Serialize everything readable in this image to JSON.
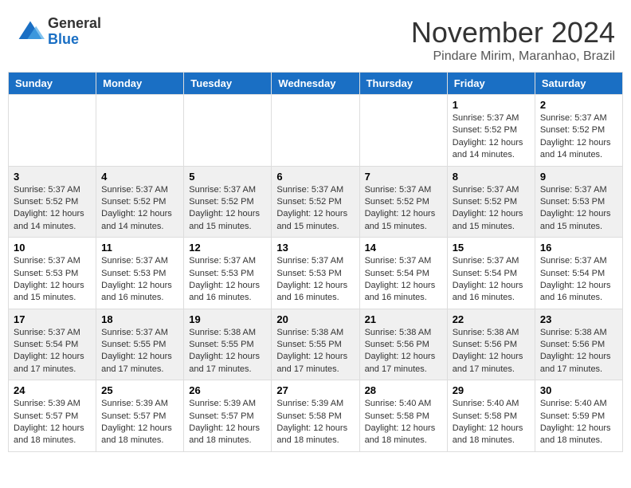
{
  "header": {
    "logo_general": "General",
    "logo_blue": "Blue",
    "month_title": "November 2024",
    "location": "Pindare Mirim, Maranhao, Brazil"
  },
  "weekdays": [
    "Sunday",
    "Monday",
    "Tuesday",
    "Wednesday",
    "Thursday",
    "Friday",
    "Saturday"
  ],
  "weeks": [
    [
      {
        "day": "",
        "info": ""
      },
      {
        "day": "",
        "info": ""
      },
      {
        "day": "",
        "info": ""
      },
      {
        "day": "",
        "info": ""
      },
      {
        "day": "",
        "info": ""
      },
      {
        "day": "1",
        "info": "Sunrise: 5:37 AM\nSunset: 5:52 PM\nDaylight: 12 hours\nand 14 minutes."
      },
      {
        "day": "2",
        "info": "Sunrise: 5:37 AM\nSunset: 5:52 PM\nDaylight: 12 hours\nand 14 minutes."
      }
    ],
    [
      {
        "day": "3",
        "info": "Sunrise: 5:37 AM\nSunset: 5:52 PM\nDaylight: 12 hours\nand 14 minutes."
      },
      {
        "day": "4",
        "info": "Sunrise: 5:37 AM\nSunset: 5:52 PM\nDaylight: 12 hours\nand 14 minutes."
      },
      {
        "day": "5",
        "info": "Sunrise: 5:37 AM\nSunset: 5:52 PM\nDaylight: 12 hours\nand 15 minutes."
      },
      {
        "day": "6",
        "info": "Sunrise: 5:37 AM\nSunset: 5:52 PM\nDaylight: 12 hours\nand 15 minutes."
      },
      {
        "day": "7",
        "info": "Sunrise: 5:37 AM\nSunset: 5:52 PM\nDaylight: 12 hours\nand 15 minutes."
      },
      {
        "day": "8",
        "info": "Sunrise: 5:37 AM\nSunset: 5:52 PM\nDaylight: 12 hours\nand 15 minutes."
      },
      {
        "day": "9",
        "info": "Sunrise: 5:37 AM\nSunset: 5:53 PM\nDaylight: 12 hours\nand 15 minutes."
      }
    ],
    [
      {
        "day": "10",
        "info": "Sunrise: 5:37 AM\nSunset: 5:53 PM\nDaylight: 12 hours\nand 15 minutes."
      },
      {
        "day": "11",
        "info": "Sunrise: 5:37 AM\nSunset: 5:53 PM\nDaylight: 12 hours\nand 16 minutes."
      },
      {
        "day": "12",
        "info": "Sunrise: 5:37 AM\nSunset: 5:53 PM\nDaylight: 12 hours\nand 16 minutes."
      },
      {
        "day": "13",
        "info": "Sunrise: 5:37 AM\nSunset: 5:53 PM\nDaylight: 12 hours\nand 16 minutes."
      },
      {
        "day": "14",
        "info": "Sunrise: 5:37 AM\nSunset: 5:54 PM\nDaylight: 12 hours\nand 16 minutes."
      },
      {
        "day": "15",
        "info": "Sunrise: 5:37 AM\nSunset: 5:54 PM\nDaylight: 12 hours\nand 16 minutes."
      },
      {
        "day": "16",
        "info": "Sunrise: 5:37 AM\nSunset: 5:54 PM\nDaylight: 12 hours\nand 16 minutes."
      }
    ],
    [
      {
        "day": "17",
        "info": "Sunrise: 5:37 AM\nSunset: 5:54 PM\nDaylight: 12 hours\nand 17 minutes."
      },
      {
        "day": "18",
        "info": "Sunrise: 5:37 AM\nSunset: 5:55 PM\nDaylight: 12 hours\nand 17 minutes."
      },
      {
        "day": "19",
        "info": "Sunrise: 5:38 AM\nSunset: 5:55 PM\nDaylight: 12 hours\nand 17 minutes."
      },
      {
        "day": "20",
        "info": "Sunrise: 5:38 AM\nSunset: 5:55 PM\nDaylight: 12 hours\nand 17 minutes."
      },
      {
        "day": "21",
        "info": "Sunrise: 5:38 AM\nSunset: 5:56 PM\nDaylight: 12 hours\nand 17 minutes."
      },
      {
        "day": "22",
        "info": "Sunrise: 5:38 AM\nSunset: 5:56 PM\nDaylight: 12 hours\nand 17 minutes."
      },
      {
        "day": "23",
        "info": "Sunrise: 5:38 AM\nSunset: 5:56 PM\nDaylight: 12 hours\nand 17 minutes."
      }
    ],
    [
      {
        "day": "24",
        "info": "Sunrise: 5:39 AM\nSunset: 5:57 PM\nDaylight: 12 hours\nand 18 minutes."
      },
      {
        "day": "25",
        "info": "Sunrise: 5:39 AM\nSunset: 5:57 PM\nDaylight: 12 hours\nand 18 minutes."
      },
      {
        "day": "26",
        "info": "Sunrise: 5:39 AM\nSunset: 5:57 PM\nDaylight: 12 hours\nand 18 minutes."
      },
      {
        "day": "27",
        "info": "Sunrise: 5:39 AM\nSunset: 5:58 PM\nDaylight: 12 hours\nand 18 minutes."
      },
      {
        "day": "28",
        "info": "Sunrise: 5:40 AM\nSunset: 5:58 PM\nDaylight: 12 hours\nand 18 minutes."
      },
      {
        "day": "29",
        "info": "Sunrise: 5:40 AM\nSunset: 5:58 PM\nDaylight: 12 hours\nand 18 minutes."
      },
      {
        "day": "30",
        "info": "Sunrise: 5:40 AM\nSunset: 5:59 PM\nDaylight: 12 hours\nand 18 minutes."
      }
    ]
  ]
}
